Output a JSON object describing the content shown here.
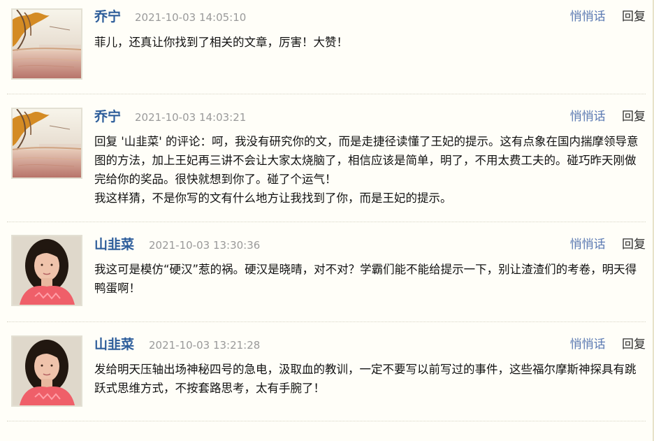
{
  "comments": [
    {
      "author": "乔宁",
      "timestamp": "2021-10-03 14:05:10",
      "whisper": "悄悄话",
      "reply": "回复",
      "text": "菲儿，还真让你找到了相关的文章，厉害！大赞！",
      "avatar": "autumn-lake"
    },
    {
      "author": "乔宁",
      "timestamp": "2021-10-03 14:03:21",
      "whisper": "悄悄话",
      "reply": "回复",
      "text": "回复 '山韭菜' 的评论：呵，我没有研究你的文，而是走捷径读懂了王妃的提示。这有点象在国内揣摩领导意图的方法，加上王妃再三讲不会让大家太烧脑了，相信应该是简单，明了，不用太费工夫的。碰巧昨天刚做完给你的奖品。很快就想到你了。碰了个运气！\n我这样猜，不是你写的文有什么地方让我找到了你，而是王妃的提示。",
      "avatar": "autumn-lake"
    },
    {
      "author": "山韭菜",
      "timestamp": "2021-10-03 13:30:36",
      "whisper": "悄悄话",
      "reply": "回复",
      "text": "我这可是模仿“硬汉”惹的祸。硬汉是晓晴，对不对？学霸们能不能给提示一下，别让渣渣们的考卷，明天得鸭蛋啊！",
      "avatar": "woman-portrait"
    },
    {
      "author": "山韭菜",
      "timestamp": "2021-10-03 13:21:28",
      "whisper": "悄悄话",
      "reply": "回复",
      "text": "发给明天压轴出场神秘四号的急电，汲取血的教训，一定不要写以前写过的事件，这些福尔摩斯神探具有跳跃式思维方式，不按套路思考，太有手腕了！",
      "avatar": "woman-portrait"
    }
  ]
}
